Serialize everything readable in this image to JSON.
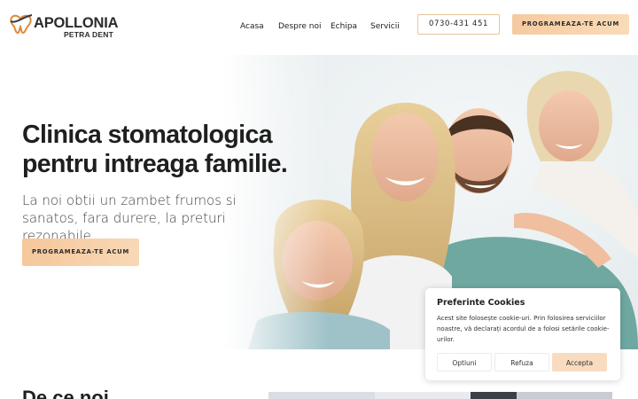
{
  "brand": {
    "name": "APOLLONIA",
    "subname": "PETRA DENT",
    "accent_color": "#f6caa0"
  },
  "nav": {
    "items": [
      {
        "label": "Acasa"
      },
      {
        "label": "Despre noi"
      },
      {
        "label": "Echipa"
      },
      {
        "label": "Servicii"
      }
    ],
    "phone": "0730-431 451",
    "cta": "PROGRAMEAZA-TE ACUM"
  },
  "hero": {
    "title": "Clinica stomatologica pentru intreaga familie.",
    "subtitle": "La noi obtii un zambet frumos si sanatos, fara durere, la preturi rezonabile",
    "cta": "PROGRAMEAZA-TE ACUM",
    "image_icon": "family-photo"
  },
  "section": {
    "title": "De ce noi"
  },
  "cookie": {
    "title": "Preferinte Cookies",
    "text": "Acest site folosește cookie-uri. Prin folosirea serviciilor noastre, vă declarați acordul de a folosi setările cookie-urilor.",
    "buttons": {
      "options": "Optiuni",
      "refuse": "Refuza",
      "accept": "Accepta"
    }
  }
}
